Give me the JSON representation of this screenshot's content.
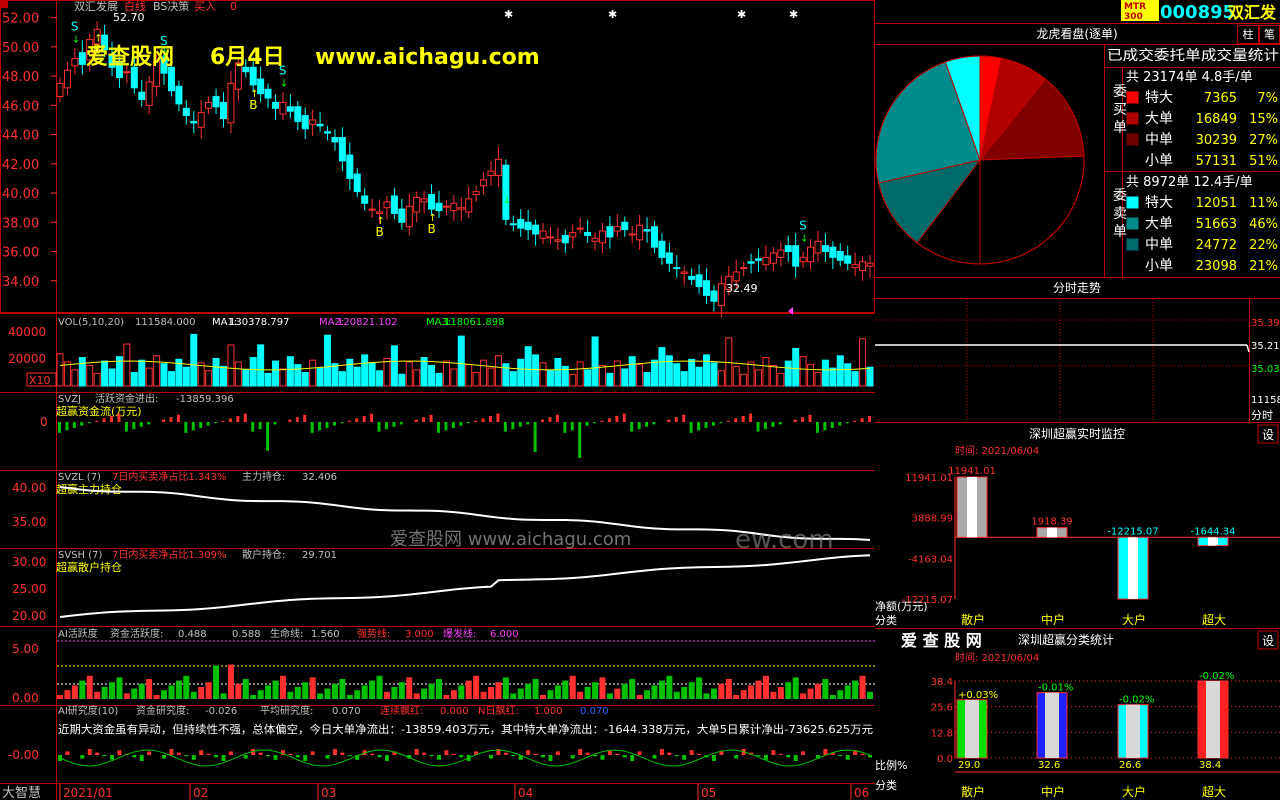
{
  "stock": {
    "name": "双汇发展",
    "indicator": "白线",
    "bs_label": "BS决策",
    "buy_label": "买入",
    "buy_value": "0",
    "tag": "MTR\n300",
    "code": "000895",
    "short_name": "双汇发"
  },
  "watermark": {
    "site": "爱查股网",
    "date": "6月4日",
    "url": "www.aichagu.com",
    "center_text": "爱查股网   www.aichagu.com",
    "center_tail": "ew.com"
  },
  "price_axis": {
    "ticks": [
      "52.00",
      "50.00",
      "48.00",
      "46.00",
      "44.00",
      "42.00",
      "40.00",
      "38.00",
      "36.00",
      "34.00"
    ],
    "high_label": "52.70",
    "low_label": "32.49",
    "s_label": "S",
    "b_label": "B"
  },
  "date_axis": [
    "2021/01",
    "02",
    "03",
    "04",
    "05",
    "06"
  ],
  "vol_panel": {
    "label": "VOL(5,10,20)",
    "value": "111584.000",
    "ma1_label": "MA1:",
    "ma1": "130378.797",
    "ma2_label": "MA2:",
    "ma2": "120821.102",
    "ma3_label": "MA3:",
    "ma3": "118061.898",
    "ticks": [
      "40000",
      "20000"
    ],
    "x10": "X10"
  },
  "svzj_panel": {
    "label": "SVZJ",
    "title": "活跃资金进出:",
    "value": "-13859.396",
    "sub": "超赢资金流(万元)",
    "tick": "0"
  },
  "svzl_panel": {
    "label": "SVZL (7)",
    "ratio_label": "7日内买卖净占比1.343%",
    "hold_label": "主力持仓:",
    "hold": "32.406",
    "sub": "超赢主力持仓",
    "ticks": [
      "40.00",
      "35.00"
    ]
  },
  "svsh_panel": {
    "label": "SVSH (7)",
    "ratio_label": "7日内买卖净占比1.309%",
    "hold_label": "散户持仓:",
    "hold": "29.701",
    "sub": "超赢散户持仓",
    "ticks": [
      "30.00",
      "25.00",
      "20.00"
    ]
  },
  "ai_panel": {
    "label": "AI活跃度",
    "act_label": "资金活跃度:",
    "act": "0.488",
    "act2": "0.588",
    "life_label": "生命线:",
    "life": "1.560",
    "strong_label": "强势线:",
    "strong": "3.000",
    "burst_label": "爆发线:",
    "burst": "6.000",
    "ticks": [
      "5.00",
      "0.00"
    ]
  },
  "ai2_panel": {
    "label": "AI研究度(10)",
    "r_label": "资金研究度:",
    "r": "-0.026",
    "avg_label": "平均研究度:",
    "avg": "0.070",
    "red_label": "连续飘红:",
    "red": "0.000",
    "n_label": "N日飘红:",
    "n": "1.000",
    "last": "0.070",
    "comment": "近期大资金虽有异动，但持续性不强，总体偏空，今日大单净流出：-13859.403万元，其中特大单净流出：-1644.338万元，大单5日累计净出-73625.625万元",
    "tick": "-0.00",
    "brand": "大智慧"
  },
  "dragon": {
    "title": "龙虎看盘(逐单)",
    "subtitle": "已成交委托单成交量统计",
    "buy_side": "委买单",
    "sell_side": "委卖单",
    "buy_total": "共 23174单 4.8手/单",
    "sell_total": "共 8972单 12.4手/单",
    "buy_rows": [
      {
        "label": "特大",
        "count": "7365",
        "pct": "7%",
        "color": "#ff0000"
      },
      {
        "label": "大单",
        "count": "16849",
        "pct": "15%",
        "color": "#b00000"
      },
      {
        "label": "中单",
        "count": "30239",
        "pct": "27%",
        "color": "#700000"
      },
      {
        "label": "小单",
        "count": "57131",
        "pct": "51%",
        "color": "#000000"
      }
    ],
    "sell_rows": [
      {
        "label": "特大",
        "count": "12051",
        "pct": "11%",
        "color": "#00ffff"
      },
      {
        "label": "大单",
        "count": "51663",
        "pct": "46%",
        "color": "#008a8a"
      },
      {
        "label": "中单",
        "count": "24772",
        "pct": "22%",
        "color": "#006a6a"
      },
      {
        "label": "小单",
        "count": "23098",
        "pct": "21%",
        "color": "#000000"
      }
    ]
  },
  "intraday": {
    "title": "分时走势",
    "ticks": [
      "35.39",
      "35.21",
      "35.03"
    ],
    "volume": "11158",
    "vol_label": "分时"
  },
  "monitor": {
    "title": "深圳超赢实时监控",
    "set_label": "设",
    "time": "时间: 2021/06/04",
    "y_label": "净额(万元)",
    "cat_label": "分类",
    "ticks": [
      "11941.01",
      "3888.99",
      "-4163.04",
      "-12215.07"
    ]
  },
  "classify": {
    "logo": "爱 查 股 网",
    "title": "深圳超赢分类统计",
    "set_label": "设",
    "time": "时间: 2021/06/04",
    "y_label": "比例%",
    "cat_label": "分类",
    "ticks": [
      "38.4",
      "25.6",
      "12.8",
      "0.0"
    ]
  },
  "chart_data": [
    {
      "type": "candlestick",
      "title": "双汇发展 日K",
      "x_dates": [
        "2021/01",
        "02",
        "03",
        "04",
        "05",
        "06"
      ],
      "ylim": [
        32.0,
        53.0
      ],
      "high_mark": 52.7,
      "low_mark": 32.49,
      "close": [
        47.5,
        48.4,
        49.2,
        48.8,
        50.5,
        51.2,
        49.8,
        48.6,
        47.9,
        48.3,
        47.2,
        46.4,
        47.6,
        49.0,
        48.2,
        47.0,
        46.1,
        45.3,
        44.8,
        45.5,
        46.2,
        45.9,
        45.1,
        47.5,
        48.9,
        48.3,
        47.4,
        46.8,
        46.5,
        45.8,
        46.2,
        45.6,
        44.9,
        44.4,
        45.0,
        44.6,
        44.1,
        43.5,
        42.2,
        41.0,
        40.1,
        39.3,
        38.9,
        38.7,
        39.4,
        38.6,
        38.0,
        39.1,
        39.7,
        39.6,
        38.9,
        38.8,
        39.1,
        39.3,
        39.0,
        39.6,
        40.1,
        40.9,
        41.5,
        42.3,
        38.2,
        37.9,
        37.6,
        37.5,
        37.2,
        37.4,
        37.0,
        36.8,
        36.6,
        37.3,
        37.6,
        37.1,
        36.9,
        37.4,
        37.0,
        37.7,
        37.5,
        37.2,
        37.8,
        37.4,
        36.3,
        35.6,
        35.2,
        34.9,
        34.6,
        34.1,
        33.6,
        33.0,
        32.6,
        33.8,
        34.3,
        34.6,
        34.9,
        35.2,
        35.4,
        35.6,
        35.9,
        36.1,
        36.0,
        35.0,
        35.6,
        36.3,
        36.7,
        36.0,
        35.6,
        35.4,
        35.2,
        35.1,
        35.3,
        35.2
      ],
      "buy_signals": 4,
      "sell_signals": 6
    },
    {
      "type": "pie",
      "title": "龙虎看盘(逐单)",
      "labels": [
        "买特大",
        "买大单",
        "买中单",
        "买小单",
        "卖小单",
        "卖中单",
        "卖大单",
        "卖特大"
      ],
      "values": [
        7365,
        16849,
        30239,
        57131,
        23098,
        24772,
        51663,
        12051
      ]
    },
    {
      "type": "bar",
      "title": "深圳超赢实时监控",
      "categories": [
        "散户",
        "中户",
        "大户",
        "超大"
      ],
      "values": [
        11941.01,
        1918.39,
        -12215.07,
        -1644.34
      ],
      "ylim": [
        -12215.07,
        11941.01
      ],
      "ylabel": "净额(万元)"
    },
    {
      "type": "bar",
      "title": "深圳超赢分类统计",
      "categories": [
        "散户",
        "中户",
        "大户",
        "超大"
      ],
      "values": [
        29.0,
        32.6,
        26.6,
        38.4
      ],
      "changes": [
        "+0.03%",
        "-0.01%",
        "-0.02%",
        "-0.02%"
      ],
      "ylim": [
        0,
        38.4
      ],
      "ylabel": "比例%"
    }
  ]
}
